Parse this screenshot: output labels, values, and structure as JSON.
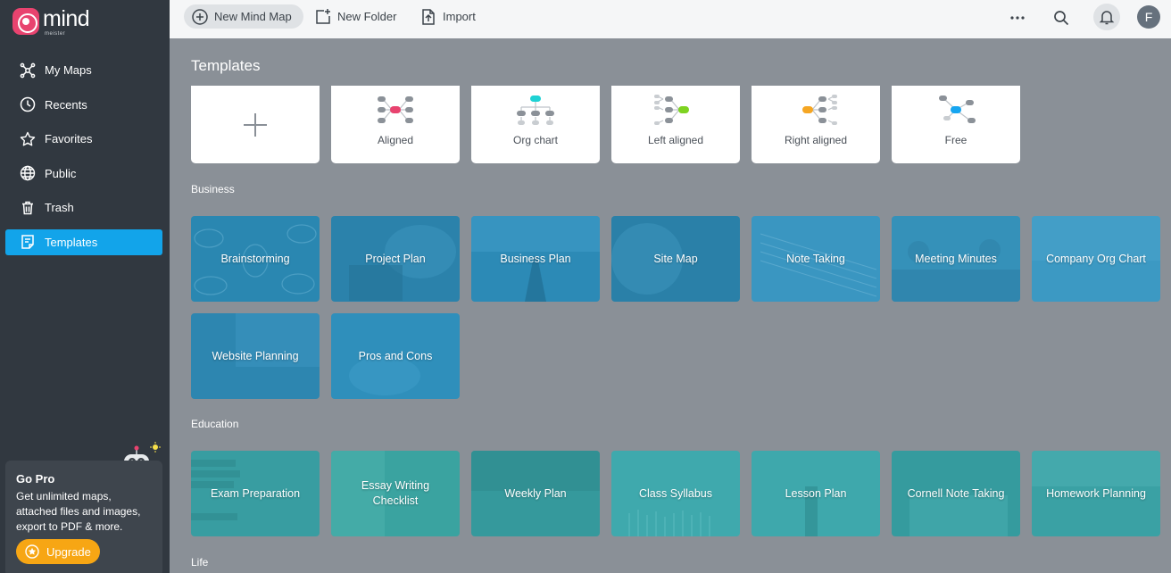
{
  "brand": {
    "name": "mind",
    "sub": "meister",
    "color": "#e8436f"
  },
  "sidebar": {
    "items": [
      {
        "label": "My Maps",
        "icon": "mindmap-icon",
        "active": false
      },
      {
        "label": "Recents",
        "icon": "clock-icon",
        "active": false
      },
      {
        "label": "Favorites",
        "icon": "star-icon",
        "active": false
      },
      {
        "label": "Public",
        "icon": "globe-icon",
        "active": false
      },
      {
        "label": "Trash",
        "icon": "trash-icon",
        "active": false
      },
      {
        "label": "Templates",
        "icon": "template-icon",
        "active": true
      }
    ],
    "gopro": {
      "title": "Go Pro",
      "text": "Get unlimited maps, attached files and images, export to PDF & more.",
      "button": "Upgrade"
    }
  },
  "topbar": {
    "new_map": "New Mind Map",
    "new_folder": "New Folder",
    "import": "Import",
    "avatar_initial": "F"
  },
  "page": {
    "title": "Templates",
    "layouts": [
      {
        "label": "",
        "type": "blank"
      },
      {
        "label": "Aligned",
        "accent": "#e8436f"
      },
      {
        "label": "Org chart",
        "accent": "#1ed2d4"
      },
      {
        "label": "Left aligned",
        "accent": "#7ed321"
      },
      {
        "label": "Right aligned",
        "accent": "#f5a623"
      },
      {
        "label": "Free",
        "accent": "#16a5f0"
      }
    ],
    "sections": {
      "business": {
        "label": "Business",
        "items": [
          "Brainstorming",
          "Project Plan",
          "Business Plan",
          "Site Map",
          "Note Taking",
          "Meeting Minutes",
          "Company Org Chart",
          "Website Planning",
          "Pros and Cons"
        ]
      },
      "education": {
        "label": "Education",
        "items": [
          "Exam Preparation",
          "Essay Writing Checklist",
          "Weekly Plan",
          "Class Syllabus",
          "Lesson Plan",
          "Cornell Note Taking",
          "Homework Planning"
        ]
      },
      "life": {
        "label": "Life"
      }
    }
  },
  "colors": {
    "active_nav": "#12a4ea",
    "upgrade": "#f7a614",
    "business_card": "#2a87b1",
    "education_card": "#3ba4a8"
  }
}
